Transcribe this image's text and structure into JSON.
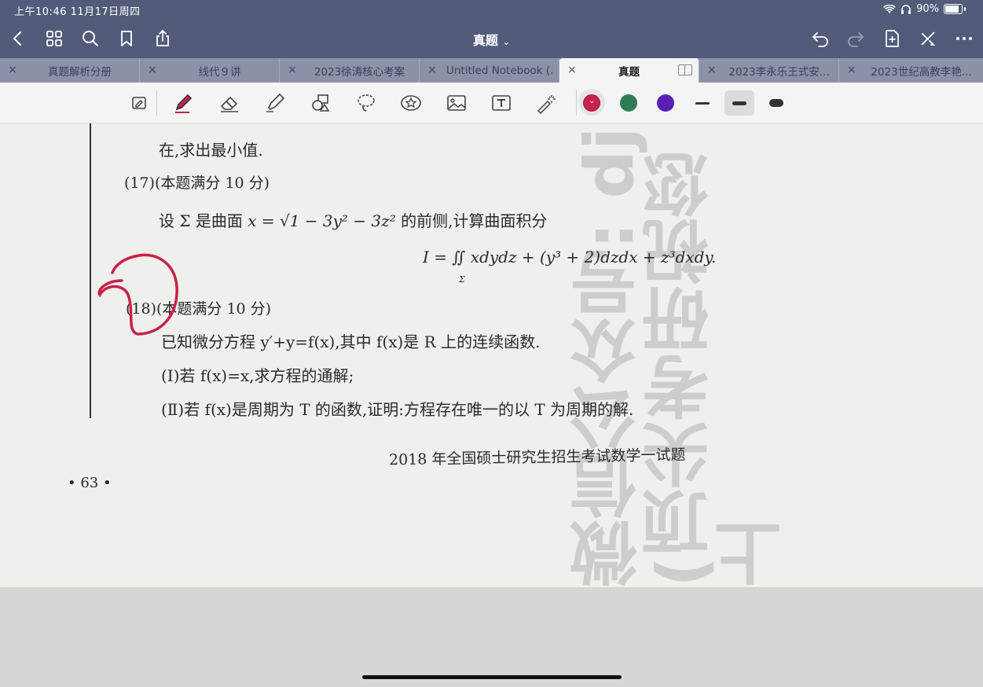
{
  "status": {
    "time_date": "上午10:46   11月17日周四",
    "battery": "90%"
  },
  "header": {
    "title": "真题",
    "title_chevron": "⌄"
  },
  "tabs": [
    {
      "label": "真题解析分册"
    },
    {
      "label": "线代９讲"
    },
    {
      "label": "2023徐涛核心考案"
    },
    {
      "label": "Untitled Notebook (..."
    },
    {
      "label": "真题"
    },
    {
      "label": "2023李永乐王式安..."
    },
    {
      "label": "2023世纪高教李艳..."
    }
  ],
  "tab_close": "×",
  "colors": {
    "pen_red": "#c8214b",
    "pen_green": "#2e7d56",
    "pen_purple": "#5a1fb5",
    "annotation": "#c8214b",
    "topbar": "#525b7a"
  },
  "document": {
    "line1": "在,求出最小值.",
    "q17_header": "(17)(本题满分 10 分)",
    "q17_text_a": "设 Σ 是曲面 ",
    "q17_text_math": "x = √1 − 3y² − 3z²",
    "q17_text_b": " 的前侧,计算曲面积分",
    "q17_integral": "I = ∬ xdydz + (y³ + 2)dzdx + z³dxdy.",
    "q17_integral_sub": "Σ",
    "q18_header": "(18)(本题满分 10 分)",
    "q18_text": "已知微分方程 y′+y=f(x),其中 f(x)是 R 上的连续函数.",
    "q18_part1": "(Ⅰ)若 f(x)=x,求方程的通解;",
    "q18_part2": "(Ⅱ)若 f(x)是周期为 T 的函数,证明:方程存在唯一的以 T 为周期的解.",
    "footer_title": "2018 年全国硕士研究生招生考试数学一试题",
    "page_number": "• 63 •",
    "watermark": "微信公众号: dj (顶尖考研祝您上"
  }
}
